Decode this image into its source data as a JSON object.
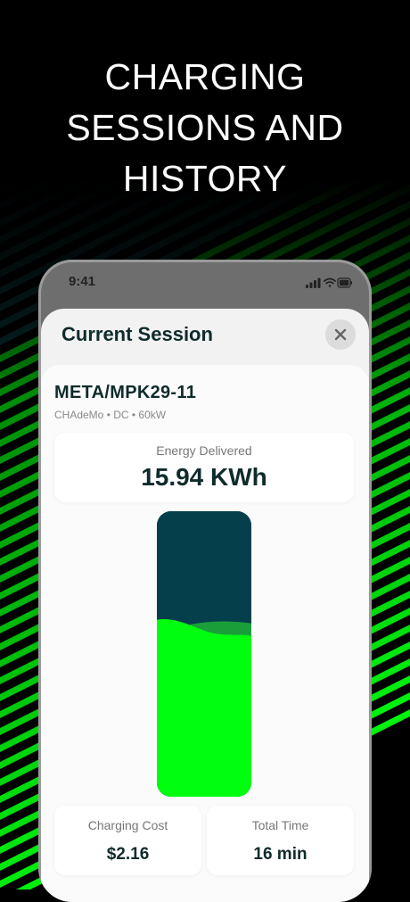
{
  "headline": [
    "CHARGING",
    "SESSIONS AND",
    "HISTORY"
  ],
  "colors": {
    "accent": "#00ff0f",
    "gauge_dark": "#063f4c",
    "text_dark": "#0f2b2b"
  },
  "status_bar": {
    "time": "9:41",
    "icons": [
      "signal-icon",
      "wifi-icon",
      "battery-icon"
    ]
  },
  "session": {
    "title": "Current Session",
    "close_icon": "close-icon",
    "station_name": "META/MPK29-11",
    "station_meta": "CHAdeMo • DC •  60kW",
    "energy_label": "Energy Delivered",
    "energy_value": "15.94 KWh",
    "gauge_fill_fraction": 0.62,
    "cost_label": "Charging Cost",
    "cost_value": "$2.16",
    "time_label": "Total Time",
    "time_value": "16 min"
  }
}
